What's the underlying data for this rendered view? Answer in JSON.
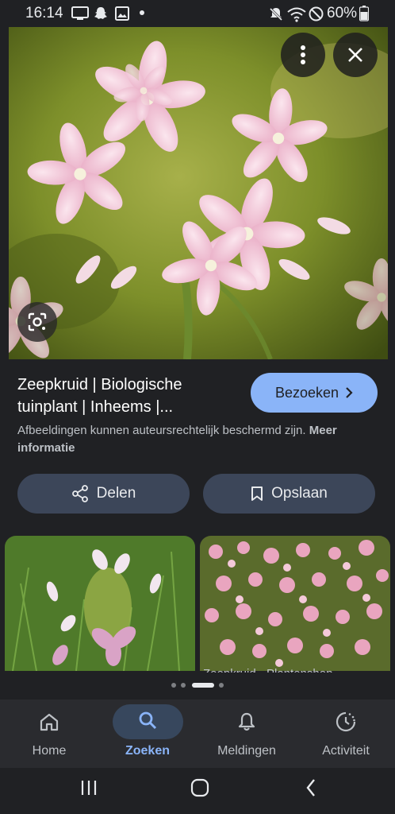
{
  "status_bar": {
    "time": "16:14",
    "battery": "60%",
    "left_icons": [
      "cast-icon",
      "snapchat-icon",
      "image-icon",
      "dot-icon"
    ],
    "right_icons": [
      "mute-icon",
      "wifi-icon",
      "dnd-icon",
      "battery-icon"
    ]
  },
  "hero": {
    "menu_icon": "more-vert-icon",
    "close_icon": "close-icon",
    "lens_icon": "lens-icon"
  },
  "result": {
    "title": "Zeepkruid | Biologische tuinplant | Inheems |...",
    "visit_label": "Bezoeken",
    "copyright_text": "Afbeeldingen kunnen auteursrechtelijk beschermd zijn.",
    "more_info": "Meer informatie"
  },
  "actions": {
    "share_label": "Delen",
    "save_label": "Opslaan"
  },
  "related": {
    "caption_2": "Zeepkruid - Plantenshop"
  },
  "bottom_nav": {
    "items": [
      {
        "label": "Home",
        "icon": "home-icon",
        "active": false
      },
      {
        "label": "Zoeken",
        "icon": "search-icon",
        "active": true
      },
      {
        "label": "Meldingen",
        "icon": "bell-icon",
        "active": false
      },
      {
        "label": "Activiteit",
        "icon": "activity-icon",
        "active": false
      }
    ]
  },
  "colors": {
    "background": "#202124",
    "accent": "#8ab4f8",
    "action_button": "#3c4659"
  }
}
